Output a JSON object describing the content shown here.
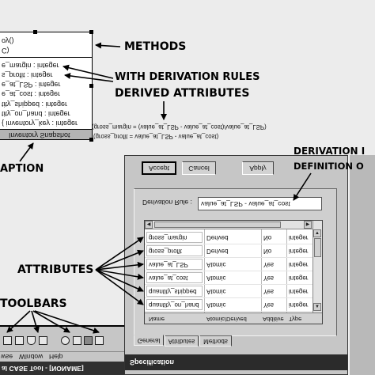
{
  "annotations": {
    "methods": "METHODS",
    "with_derivation_rules": "WITH DERIVATION RULES",
    "derived_attributes": "DERIVED ATTRIBUTES",
    "caption": "APTION",
    "derivation": "DERIVATION I",
    "definition": "DEFINITION O",
    "attributes": "ATTRIBUTES",
    "toolbars": "TOOLBARS"
  },
  "class_box": {
    "methods": [
      "oy()",
      "C)"
    ],
    "attributes": [
      "e_margin : integer",
      "s_profit : integer",
      "e_at_LSP : integer",
      "e_at_cost : integer",
      "tity_shipped : integer",
      "tity_on_hand : integer",
      "{ inventory_key : integer"
    ],
    "title": "Inventory Snapshot"
  },
  "derivation_rules": [
    "(gross_margin = (value_at_LSP - value_at_cost)/value_at_LSP)",
    "(gross_profit = value_at_LSP - value_at_cost)"
  ],
  "dialog": {
    "title": "Specification",
    "buttons": {
      "accept": "Accept",
      "cancel": "Cancel",
      "apply": "Apply"
    },
    "derivation_rule": {
      "label": "Derivation Rule :",
      "value": "value_at_LSP - value_at_cost"
    },
    "table": {
      "columns": [
        "Name",
        "Atomic/Derived",
        "Additive",
        "Type"
      ],
      "rows": [
        [
          "gross_margin",
          "Derived",
          "No",
          "integer"
        ],
        [
          "gross_profit",
          "Derived",
          "No",
          "integer"
        ],
        [
          "value_at_LSP",
          "Atomic",
          "Yes",
          "integer"
        ],
        [
          "value_at_cost",
          "Atomic",
          "Yes",
          "integer"
        ],
        [
          "quantity_shipped",
          "Atomic",
          "Yes",
          "integer"
        ],
        [
          "quantity_on_hand",
          "Atomic",
          "Yes",
          "integer"
        ]
      ]
    },
    "tabs": [
      "General",
      "Attributes",
      "Methods"
    ],
    "active_tab_index": 0
  },
  "main_window": {
    "title": "al CASE Tool - [NONAME]",
    "menu": [
      "wse",
      "Window",
      "Help"
    ]
  },
  "colors": {
    "title_bar": "#2b2b2b",
    "dialog_face": "#c6c6c6",
    "page_background": "#ececec"
  }
}
